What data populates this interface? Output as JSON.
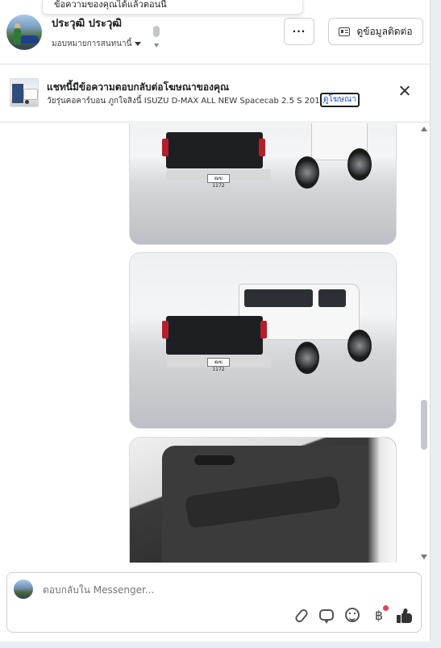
{
  "toast": {
    "text": "ข้อความของคุณได้แล้วตอนนี้"
  },
  "header": {
    "name": "ประวุฒิ ประวุฒิ",
    "assign_label": "มอบหมายการสนทนานี้",
    "more_label": "···",
    "contact_label": "ดูข้อมูลติดต่อ"
  },
  "ad": {
    "title": "แชทนี้มีข้อความตอบกลับต่อโฆษณาของคุณ",
    "subtitle": "วัยรุ่นคอคาร์บอน ภูกใจสิงนี้ ISUZU D-MAX ALL NEW Spacecab 2.5 S 201...",
    "link_label": "ดูโฆษณา",
    "close_icon": "close-icon"
  },
  "photos": [
    {
      "plate": "ฒฆ 1172"
    },
    {
      "plate": "ฒฆ 1172"
    }
  ],
  "composer": {
    "placeholder": "ตอบกลับใน Messenger...",
    "baht_symbol": "฿"
  },
  "colors": {
    "accent": "#1b56c6",
    "notification_dot": "#e4405f"
  }
}
